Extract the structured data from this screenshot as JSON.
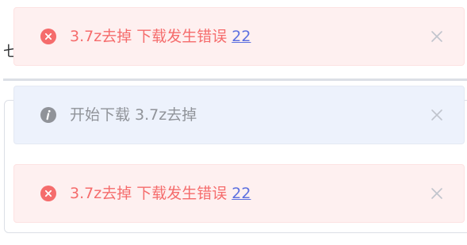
{
  "background": {
    "partial_text": "七"
  },
  "notifications": [
    {
      "type": "error",
      "icon": "error-circle-icon",
      "message": "3.7z去掉 下载发生错误",
      "link": "22"
    },
    {
      "type": "info",
      "icon": "info-circle-icon",
      "message": "开始下载 3.7z去掉"
    },
    {
      "type": "error",
      "icon": "error-circle-icon",
      "message": "3.7z去掉 下载发生错误",
      "link": "22"
    }
  ],
  "colors": {
    "error_text": "#f56c6c",
    "error_bg": "#fef0f0",
    "info_text": "#909399",
    "info_bg": "#edf2fc",
    "link": "#5c6fe0",
    "close": "#c0c4cc"
  }
}
